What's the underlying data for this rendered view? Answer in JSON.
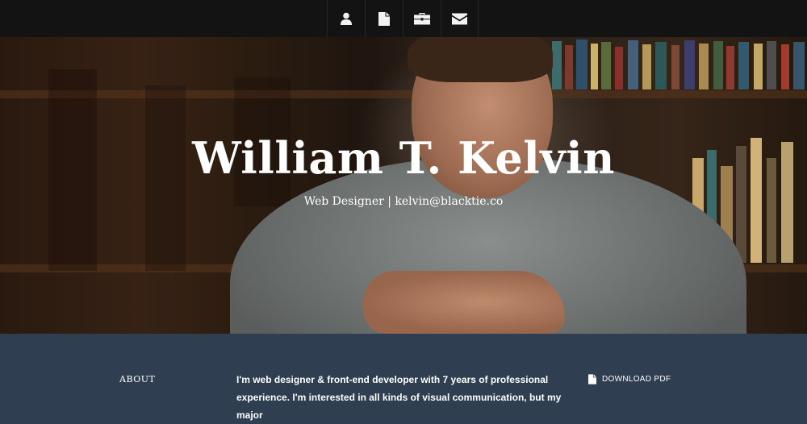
{
  "nav": {
    "items": [
      {
        "icon": "user-icon"
      },
      {
        "icon": "file-icon"
      },
      {
        "icon": "briefcase-icon"
      },
      {
        "icon": "envelope-icon"
      }
    ]
  },
  "hero": {
    "title": "William T. Kelvin",
    "subtitle": "Web Designer | kelvin@blacktie.co"
  },
  "about": {
    "heading": "ABOUT",
    "text": "I'm web designer & front-end developer with 7 years of professional experience. I'm interested in all kinds of visual communication, but my major",
    "download_label": "DOWNLOAD PDF",
    "download_icon": "file-icon"
  },
  "colors": {
    "navbar": "#131313",
    "about_background": "#2f3e50",
    "text": "#ffffff"
  }
}
